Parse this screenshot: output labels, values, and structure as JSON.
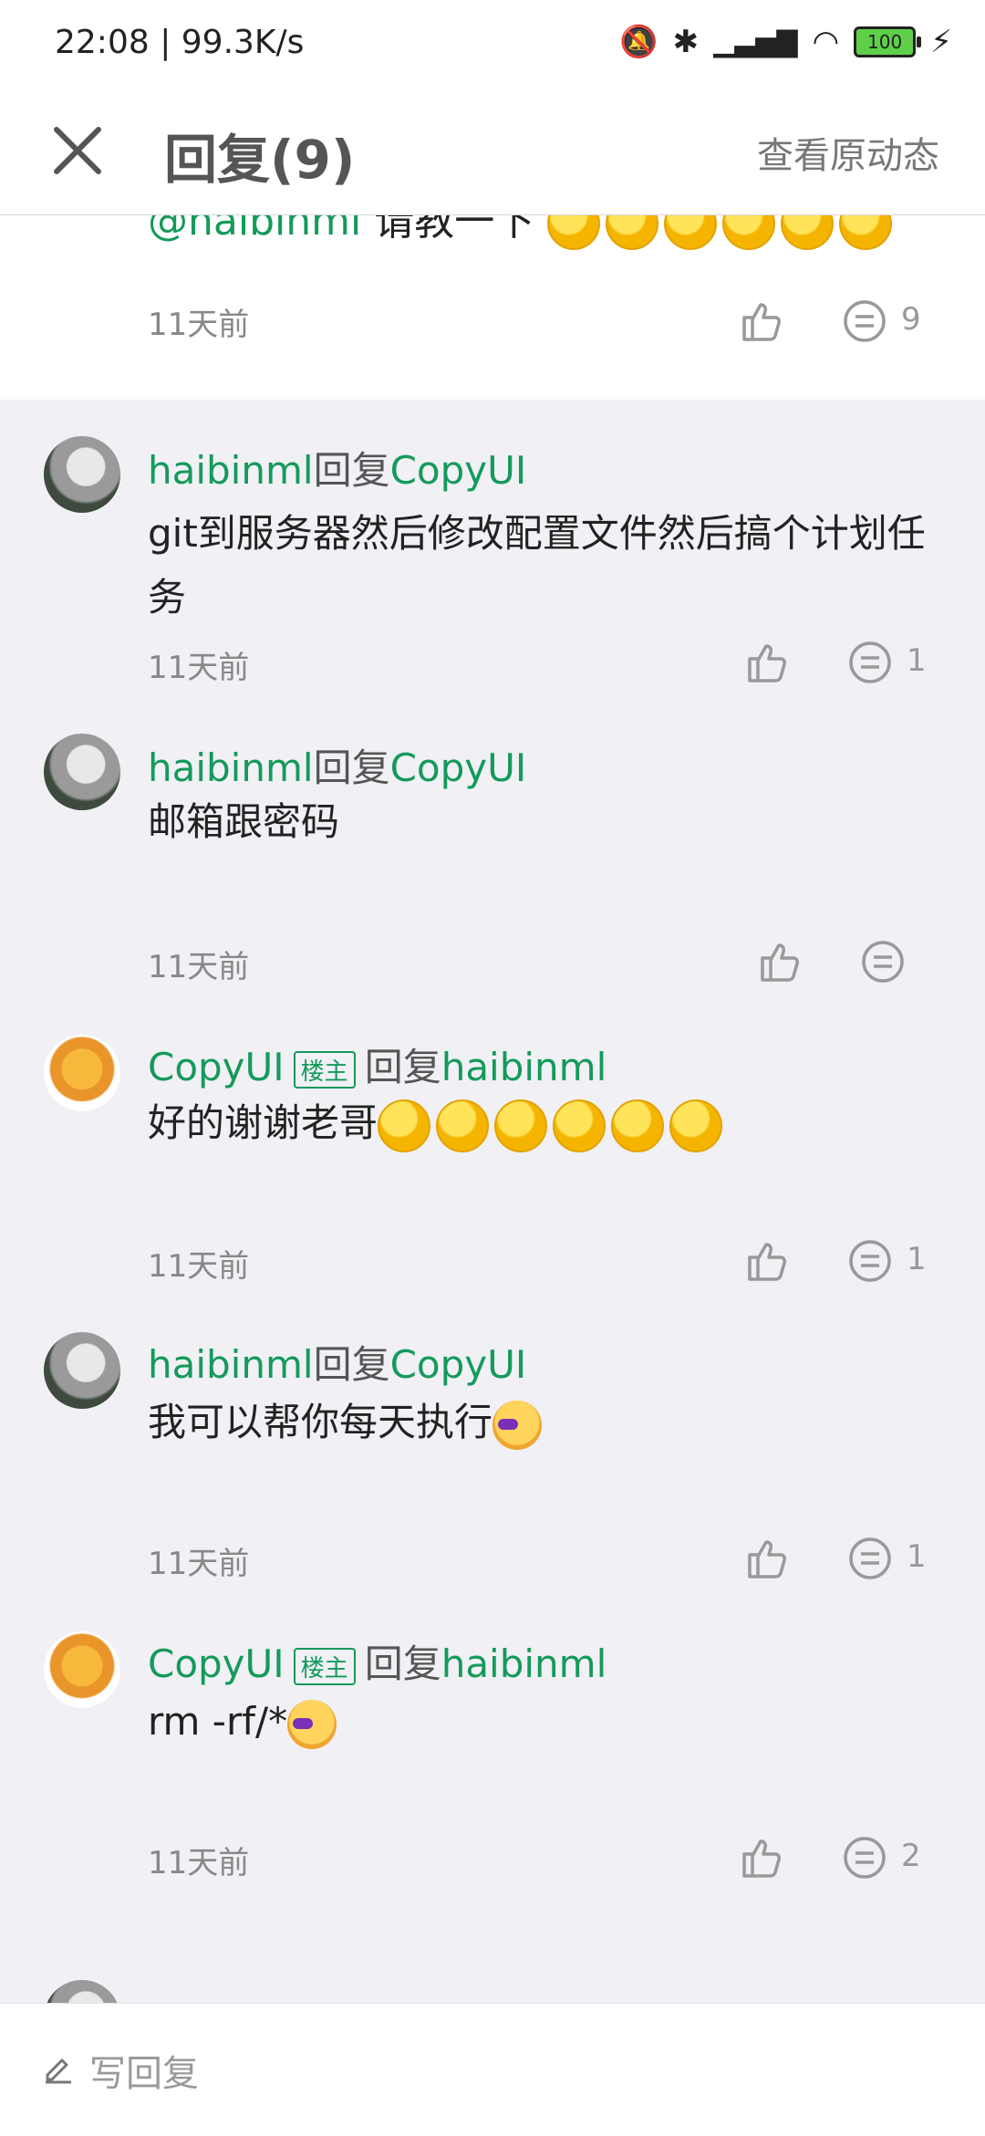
{
  "status_bar": {
    "time": "22:08 | 99.3K/s",
    "battery": "100"
  },
  "header": {
    "title": "回复(9)",
    "view_original": "查看原动态"
  },
  "top_comment": {
    "mention": "@haibinml",
    "text": " 请教一下",
    "time": "11天前",
    "reply_count": "9"
  },
  "replies": [
    {
      "author": "haibinml",
      "reply_word": "回复",
      "target": "CopyUI",
      "owner": false,
      "text": "git到服务器然后修改配置文件然后搞个计划任务",
      "time": "11天前",
      "count": "1"
    },
    {
      "author": "haibinml",
      "reply_word": "回复",
      "target": "CopyUI",
      "owner": false,
      "text": "邮箱跟密码",
      "time": "11天前",
      "count": ""
    },
    {
      "author": "CopyUI",
      "owner_badge": "楼主",
      "reply_word": "回复",
      "target": "haibinml",
      "owner": true,
      "text": "好的谢谢老哥",
      "time": "11天前",
      "count": "1"
    },
    {
      "author": "haibinml",
      "reply_word": "回复",
      "target": "CopyUI",
      "owner": false,
      "text": "我可以帮你每天执行",
      "time": "11天前",
      "count": "1"
    },
    {
      "author": "CopyUI",
      "owner_badge": "楼主",
      "reply_word": "回复",
      "target": "haibinml",
      "owner": true,
      "text": "rm -rf/*",
      "time": "11天前",
      "count": "2"
    }
  ],
  "reply_bar": {
    "placeholder": "写回复"
  },
  "colors": {
    "accent": "#149a5a",
    "background": "#f0f0f5"
  }
}
